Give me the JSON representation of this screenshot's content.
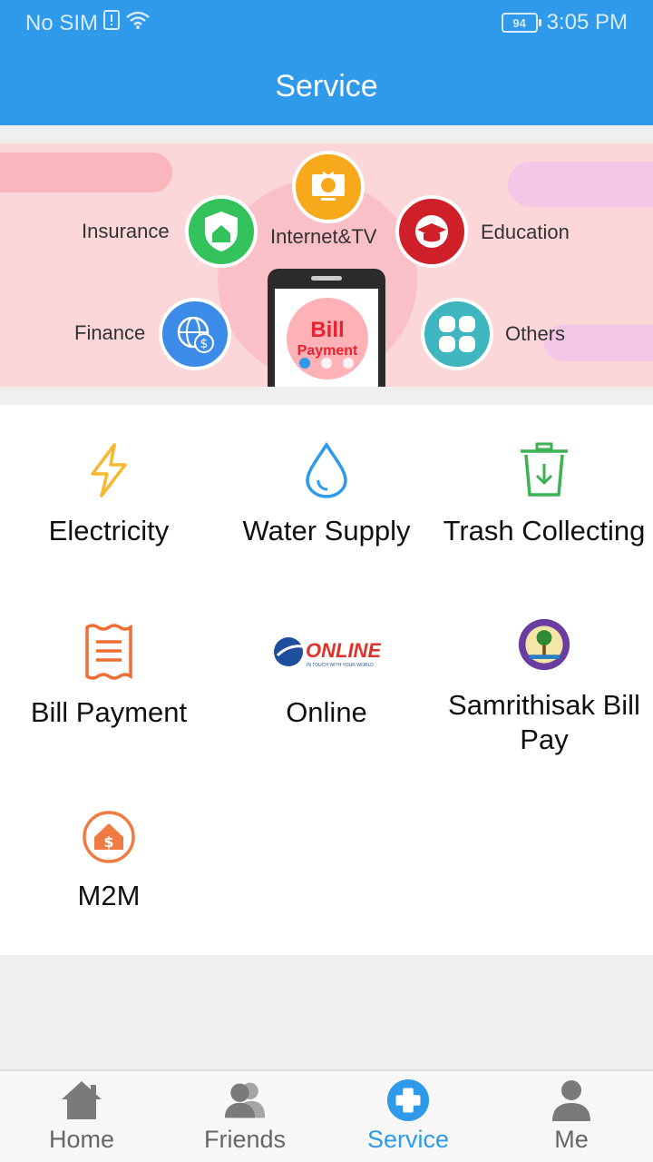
{
  "status": {
    "carrier": "No SIM",
    "battery": "94",
    "time": "3:05 PM"
  },
  "header": {
    "title": "Service"
  },
  "banner": {
    "categories": {
      "insurance": "Insurance",
      "internet_tv": "Internet&TV",
      "education": "Education",
      "finance": "Finance",
      "others": "Others"
    },
    "phone_text_1": "Bill",
    "phone_text_2": "Payment",
    "pager": {
      "count": 3,
      "active": 0
    }
  },
  "services": [
    {
      "label": "Electricity",
      "icon": "lightning-icon"
    },
    {
      "label": "Water Supply",
      "icon": "water-drop-icon"
    },
    {
      "label": "Trash Collecting",
      "icon": "trash-bin-icon"
    },
    {
      "label": "Bill Payment",
      "icon": "receipt-icon"
    },
    {
      "label": "Online",
      "icon": "online-logo"
    },
    {
      "label": "Samrithisak Bill Pay",
      "icon": "samrithisak-logo"
    },
    {
      "label": "M2M",
      "icon": "house-dollar-icon"
    }
  ],
  "online_logo_text": "ONLINE",
  "online_logo_tagline": "IN TOUCH WITH YOUR WORLD",
  "tabs": [
    {
      "label": "Home",
      "icon": "home-icon",
      "active": false
    },
    {
      "label": "Friends",
      "icon": "friends-icon",
      "active": false
    },
    {
      "label": "Service",
      "icon": "plus-circle-icon",
      "active": true
    },
    {
      "label": "Me",
      "icon": "person-icon",
      "active": false
    }
  ],
  "colors": {
    "accent": "#2f9ae9",
    "banner_bg": "#fbd7d9"
  }
}
